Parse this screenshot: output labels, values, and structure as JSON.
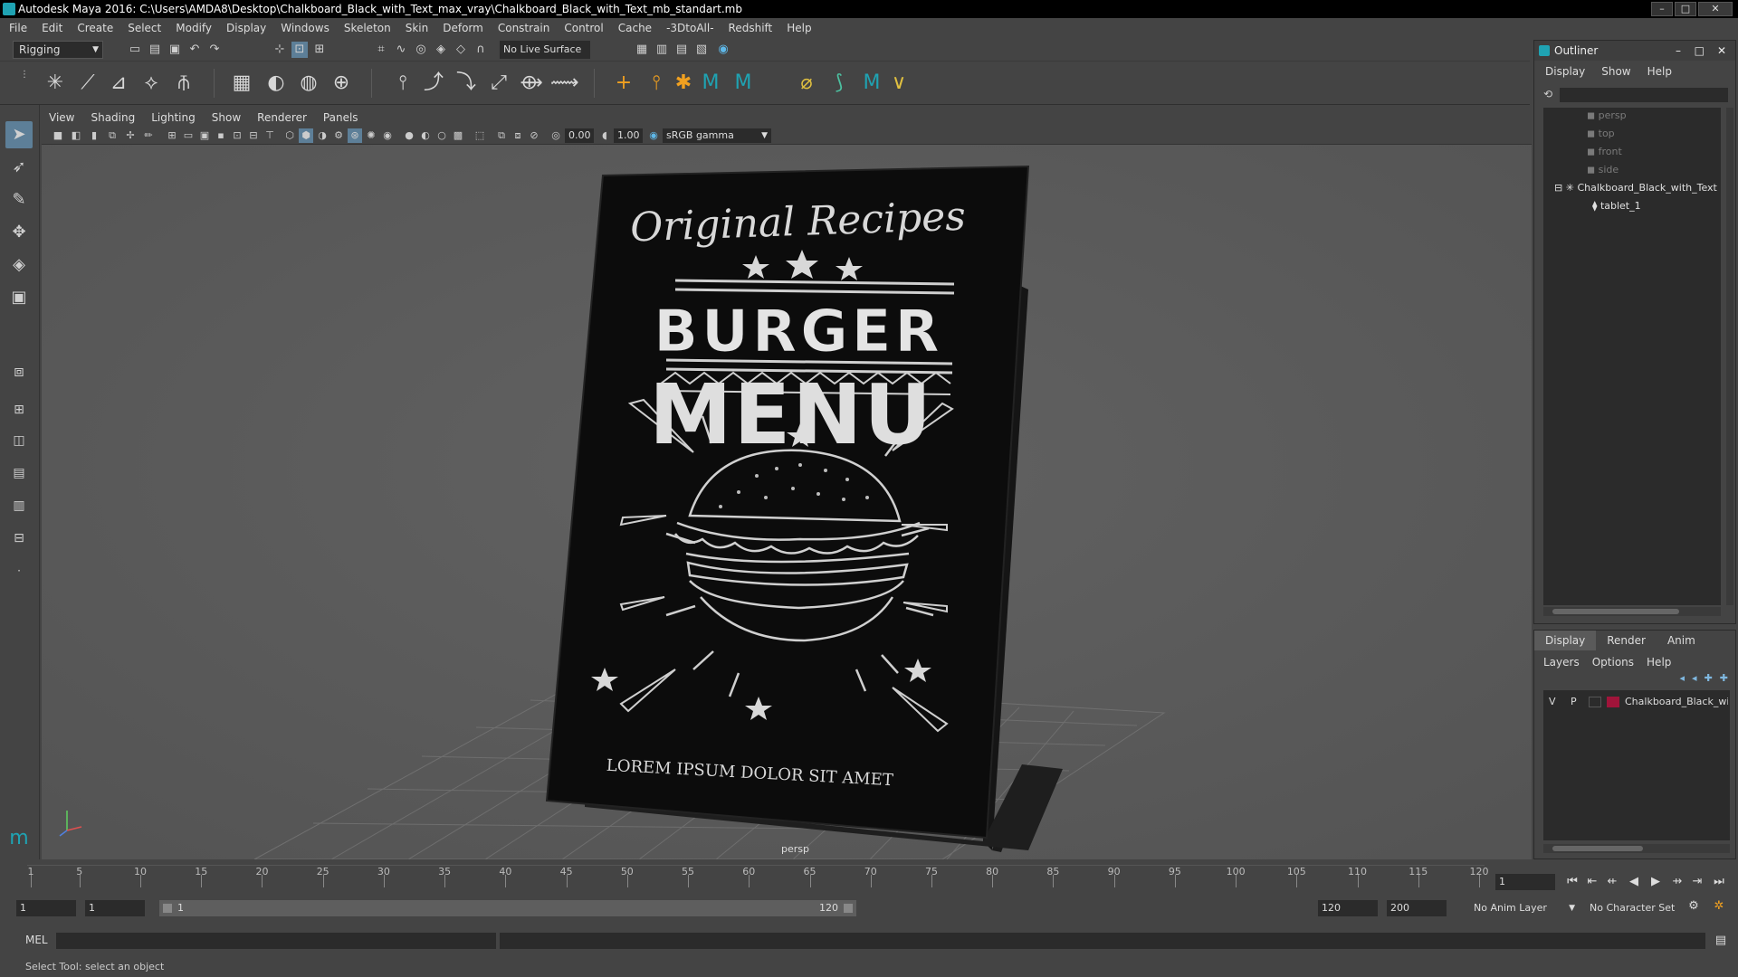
{
  "window": {
    "title": "Autodesk Maya 2016: C:\\Users\\AMDA8\\Desktop\\Chalkboard_Black_with_Text_max_vray\\Chalkboard_Black_with_Text_mb_standart.mb",
    "controls": [
      "minimize",
      "maximize",
      "close"
    ]
  },
  "menubar": [
    "File",
    "Edit",
    "Create",
    "Select",
    "Modify",
    "Display",
    "Windows",
    "Skeleton",
    "Skin",
    "Deform",
    "Constrain",
    "Control",
    "Cache",
    "-3DtoAll-",
    "Redshift",
    "Help"
  ],
  "statusline": {
    "mode": "Rigging",
    "live_surface": "No Live Surface"
  },
  "panel": {
    "menus": [
      "View",
      "Shading",
      "Lighting",
      "Show",
      "Renderer",
      "Panels"
    ],
    "exposure": "0.00",
    "gamma": "1.00",
    "color_space": "sRGB gamma",
    "camera_label": "persp"
  },
  "chalkboard": {
    "line1": "Original Recipes",
    "line2": "BURGER",
    "line3": "MENU",
    "line4": "LOREM IPSUM DOLOR SIT AMET"
  },
  "outliner": {
    "title": "Outliner",
    "menus": [
      "Display",
      "Show",
      "Help"
    ],
    "items": [
      {
        "label": "persp",
        "dim": true,
        "indent": 2
      },
      {
        "label": "top",
        "dim": true,
        "indent": 2
      },
      {
        "label": "front",
        "dim": true,
        "indent": 2
      },
      {
        "label": "side",
        "dim": true,
        "indent": 2
      },
      {
        "label": "Chalkboard_Black_with_Text",
        "dim": false,
        "indent": 1
      },
      {
        "label": "tablet_1",
        "dim": false,
        "indent": 3
      }
    ]
  },
  "layers": {
    "tabs": [
      "Display",
      "Render",
      "Anim"
    ],
    "active_tab": "Display",
    "menus": [
      "Layers",
      "Options",
      "Help"
    ],
    "rows": [
      {
        "visible": "V",
        "playback": "P",
        "color": "#a0143a",
        "name": "Chalkboard_Black_with_Text"
      }
    ]
  },
  "timeline": {
    "ticks": [
      1,
      5,
      10,
      15,
      20,
      25,
      30,
      35,
      40,
      45,
      50,
      55,
      60,
      65,
      70,
      75,
      80,
      85,
      90,
      95,
      100,
      105,
      110,
      115,
      120
    ],
    "min": 1,
    "max": 120,
    "current_frame": "1"
  },
  "range": {
    "start": "1",
    "playback_start": "1",
    "slider_start": "1",
    "slider_end": "120",
    "playback_end": "120",
    "end": "200",
    "anim_layer": "No Anim Layer",
    "character_set": "No Character Set"
  },
  "cmdline": {
    "label": "MEL"
  },
  "help_line": "Select Tool: select an object",
  "colors": {
    "ui_bg": "#444444",
    "viewport_bg": "#5a5a5a",
    "field_bg": "#2b2b2b",
    "accent": "#5d7f98",
    "maya_teal": "#1fa3b3"
  }
}
